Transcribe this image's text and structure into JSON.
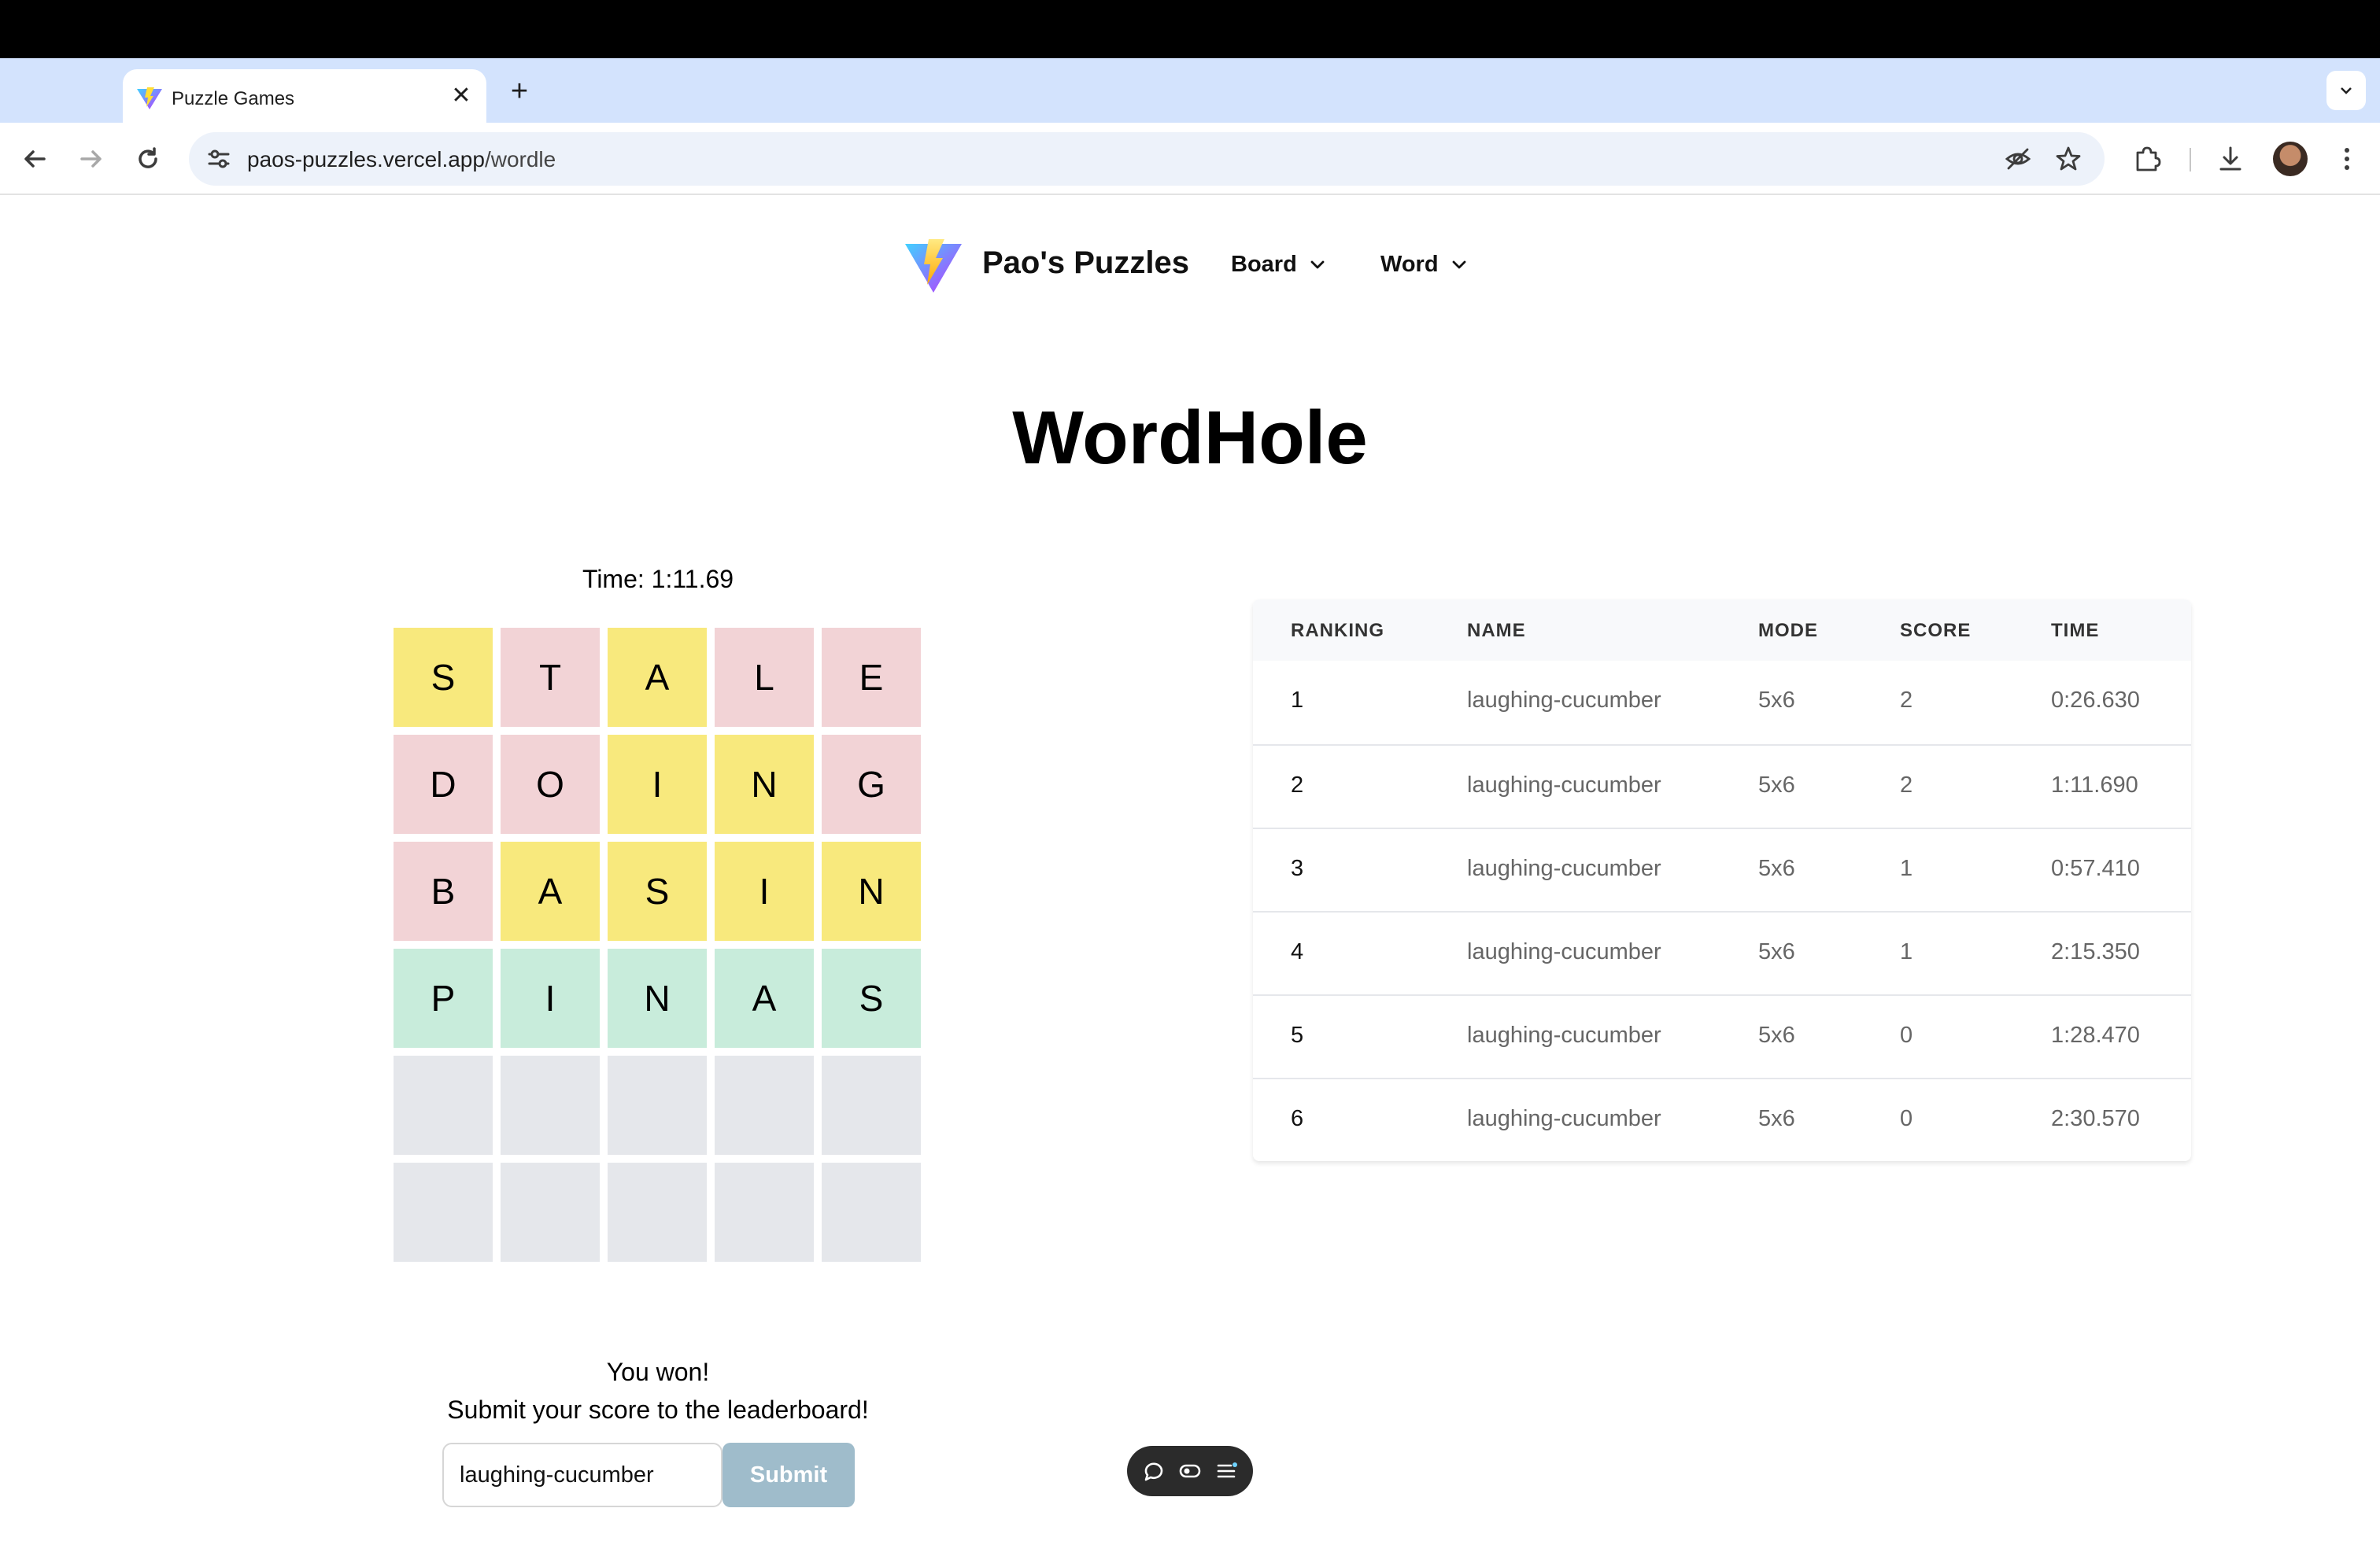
{
  "browser": {
    "tab_title": "Puzzle Games",
    "tab_close": "✕",
    "new_tab": "+",
    "tab_search": "⌄",
    "url_host": "paos-puzzles.vercel.app",
    "url_path": "/wordle"
  },
  "header": {
    "brand": "Pao's Puzzles",
    "menus": [
      {
        "label": "Board"
      },
      {
        "label": "Word"
      }
    ]
  },
  "game": {
    "title": "WordHole",
    "timer": "Time: 1:11.69",
    "board": [
      [
        {
          "l": "S",
          "s": "present"
        },
        {
          "l": "T",
          "s": "absent"
        },
        {
          "l": "A",
          "s": "present"
        },
        {
          "l": "L",
          "s": "absent"
        },
        {
          "l": "E",
          "s": "absent"
        }
      ],
      [
        {
          "l": "D",
          "s": "absent"
        },
        {
          "l": "O",
          "s": "absent"
        },
        {
          "l": "I",
          "s": "present"
        },
        {
          "l": "N",
          "s": "present"
        },
        {
          "l": "G",
          "s": "absent"
        }
      ],
      [
        {
          "l": "B",
          "s": "absent"
        },
        {
          "l": "A",
          "s": "present"
        },
        {
          "l": "S",
          "s": "present"
        },
        {
          "l": "I",
          "s": "present"
        },
        {
          "l": "N",
          "s": "present"
        }
      ],
      [
        {
          "l": "P",
          "s": "correct"
        },
        {
          "l": "I",
          "s": "correct"
        },
        {
          "l": "N",
          "s": "correct"
        },
        {
          "l": "A",
          "s": "correct"
        },
        {
          "l": "S",
          "s": "correct"
        }
      ],
      [
        {
          "l": "",
          "s": "empty"
        },
        {
          "l": "",
          "s": "empty"
        },
        {
          "l": "",
          "s": "empty"
        },
        {
          "l": "",
          "s": "empty"
        },
        {
          "l": "",
          "s": "empty"
        }
      ],
      [
        {
          "l": "",
          "s": "empty"
        },
        {
          "l": "",
          "s": "empty"
        },
        {
          "l": "",
          "s": "empty"
        },
        {
          "l": "",
          "s": "empty"
        },
        {
          "l": "",
          "s": "empty"
        }
      ]
    ],
    "won_message": "You won!",
    "submit_message": "Submit your score to the leaderboard!",
    "name_value": "laughing-cucumber",
    "submit_label": "Submit"
  },
  "colors": {
    "present": "#f8e97d",
    "absent": "#f2d3d6",
    "correct": "#c8ecdb",
    "empty": "#e5e7eb",
    "submit_button": "#9fbccb"
  },
  "leaderboard": {
    "columns": [
      "RANKING",
      "NAME",
      "MODE",
      "SCORE",
      "TIME"
    ],
    "rows": [
      [
        "1",
        "laughing-cucumber",
        "5x6",
        "2",
        "0:26.630"
      ],
      [
        "2",
        "laughing-cucumber",
        "5x6",
        "2",
        "1:11.690"
      ],
      [
        "3",
        "laughing-cucumber",
        "5x6",
        "1",
        "0:57.410"
      ],
      [
        "4",
        "laughing-cucumber",
        "5x6",
        "1",
        "2:15.350"
      ],
      [
        "5",
        "laughing-cucumber",
        "5x6",
        "0",
        "1:28.470"
      ],
      [
        "6",
        "laughing-cucumber",
        "5x6",
        "0",
        "2:30.570"
      ]
    ]
  },
  "icons": {
    "tab_favicon": "vite-logo-icon",
    "back": "arrow-left-icon",
    "forward": "arrow-right-icon",
    "reload": "reload-icon",
    "site_info": "tune-icon",
    "eye_off": "eye-off-icon",
    "star": "star-icon",
    "extensions": "puzzle-piece-icon",
    "download": "download-icon",
    "menu": "kebab-menu-icon",
    "float_chat": "chat-bubble-icon",
    "float_toggle": "toggle-icon",
    "float_list": "list-icon"
  }
}
